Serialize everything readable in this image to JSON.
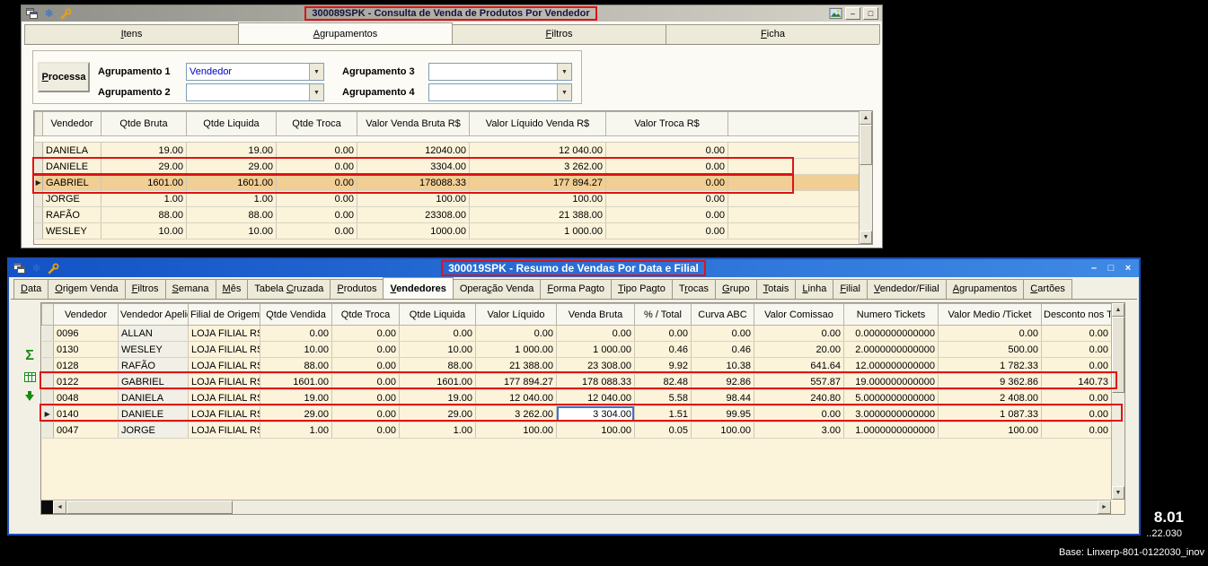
{
  "colors": {
    "annotation": "#DE1414",
    "cream": "#FBF3DA",
    "selected": "#F1CE93",
    "blue1": "#1353C6",
    "blue2": "#3F8AE4",
    "gray1": "#909088",
    "gray2": "#D6D3C9",
    "combo_text": "#0000C8",
    "green": "#168A16",
    "iceblue": "#2F6FD2"
  },
  "icons": {
    "snowflake": "❄",
    "sigma": "Σ",
    "minimize": "–",
    "maximize": "□",
    "close": "×",
    "arrow_up": "▲",
    "arrow_down": "▼",
    "arrow_left": "◄",
    "arrow_right": "►",
    "row_arrow": "▶",
    "combo_arrow": "▼"
  },
  "footer": {
    "version": "8.01",
    "build": "..22.030",
    "base": "Base: Linxerp-801-0122030_inov"
  },
  "window_consulta": {
    "title": "300089SPK - Consulta de Venda de Produtos Por Vendedor",
    "active_tab": 1,
    "tabs": [
      {
        "label": "Itens",
        "accel": 0
      },
      {
        "label": "Agrupamentos",
        "accel": 0
      },
      {
        "label": "Filtros",
        "accel": 0
      },
      {
        "label": "Ficha",
        "accel": 0
      }
    ],
    "processa": {
      "label": "Processa",
      "accel": 0
    },
    "groupings": [
      {
        "label": "Agrupamento 1",
        "value": "Vendedor"
      },
      {
        "label": "Agrupamento 2",
        "value": ""
      },
      {
        "label": "Agrupamento 3",
        "value": ""
      },
      {
        "label": "Agrupamento 4",
        "value": ""
      }
    ],
    "grid": {
      "columns": [
        "Vendedor",
        "Qtde Bruta",
        "Qtde Liquida",
        "Qtde Troca",
        "Valor Venda Bruta R$",
        "Valor Líquido Venda R$",
        "Valor Troca R$"
      ],
      "rows": [
        [
          "DANIELA",
          "19.00",
          "19.00",
          "0.00",
          "12040.00",
          "12 040.00",
          "0.00"
        ],
        [
          "DANIELE",
          "29.00",
          "29.00",
          "0.00",
          "3304.00",
          "3 262.00",
          "0.00"
        ],
        [
          "GABRIEL",
          "1601.00",
          "1601.00",
          "0.00",
          "178088.33",
          "177 894.27",
          "0.00"
        ],
        [
          "JORGE",
          "1.00",
          "1.00",
          "0.00",
          "100.00",
          "100.00",
          "0.00"
        ],
        [
          "RAFÃO",
          "88.00",
          "88.00",
          "0.00",
          "23308.00",
          "21 388.00",
          "0.00"
        ],
        [
          "WESLEY",
          "10.00",
          "10.00",
          "0.00",
          "1000.00",
          "1 000.00",
          "0.00"
        ]
      ],
      "selected_row": 2,
      "arrow_row": 2,
      "left_cols": 1
    }
  },
  "window_resumo": {
    "title": "300019SPK - Resumo de Vendas Por Data e Filial",
    "active_tab": 7,
    "tabs": [
      {
        "label": "Data",
        "accel": 0
      },
      {
        "label": "Origem Venda",
        "accel": 0
      },
      {
        "label": "Filtros",
        "accel": 0
      },
      {
        "label": "Semana",
        "accel": 0
      },
      {
        "label": "Mês",
        "accel": 0
      },
      {
        "label": "Tabela Cruzada",
        "accel": 7
      },
      {
        "label": "Produtos",
        "accel": 0
      },
      {
        "label": "Vendedores",
        "accel": 0
      },
      {
        "label": "Operação Venda",
        "accel": 5
      },
      {
        "label": "Forma Pagto",
        "accel": 0
      },
      {
        "label": "Tipo Pagto",
        "accel": 0
      },
      {
        "label": "Trocas",
        "accel": 1
      },
      {
        "label": "Grupo",
        "accel": 0
      },
      {
        "label": "Totais",
        "accel": 0
      },
      {
        "label": "Linha",
        "accel": 0
      },
      {
        "label": "Filial",
        "accel": 0
      },
      {
        "label": "Vendedor/Filial",
        "accel": 0
      },
      {
        "label": "Agrupamentos",
        "accel": 0
      },
      {
        "label": "Cartões",
        "accel": 0
      }
    ],
    "grid": {
      "columns": [
        "Vendedor",
        "Vendedor Apelido",
        "Filial de Origem",
        "Qtde Vendida",
        "Qtde Troca",
        "Qtde Liquida",
        "Valor Líquido",
        "Venda Bruta",
        "% / Total",
        "Curva ABC",
        "Valor Comissao",
        "Numero Tickets",
        "Valor Medio /Ticket",
        "Desconto nos Tick"
      ],
      "rows": [
        [
          "0096",
          "ALLAN",
          "LOJA FILIAL RS",
          "0.00",
          "0.00",
          "0.00",
          "0.00",
          "0.00",
          "0.00",
          "0.00",
          "0.00",
          "0.0000000000000",
          "0.00",
          "0.00"
        ],
        [
          "0130",
          "WESLEY",
          "LOJA FILIAL RS",
          "10.00",
          "0.00",
          "10.00",
          "1 000.00",
          "1 000.00",
          "0.46",
          "0.46",
          "20.00",
          "2.0000000000000",
          "500.00",
          "0.00"
        ],
        [
          "0128",
          "RAFÃO",
          "LOJA FILIAL RS",
          "88.00",
          "0.00",
          "88.00",
          "21 388.00",
          "23 308.00",
          "9.92",
          "10.38",
          "641.64",
          "12.000000000000",
          "1 782.33",
          "0.00"
        ],
        [
          "0122",
          "GABRIEL",
          "LOJA FILIAL RS",
          "1601.00",
          "0.00",
          "1601.00",
          "177 894.27",
          "178 088.33",
          "82.48",
          "92.86",
          "557.87",
          "19.000000000000",
          "9 362.86",
          "140.73"
        ],
        [
          "0048",
          "DANIELA",
          "LOJA FILIAL RS",
          "19.00",
          "0.00",
          "19.00",
          "12 040.00",
          "12 040.00",
          "5.58",
          "98.44",
          "240.80",
          "5.0000000000000",
          "2 408.00",
          "0.00"
        ],
        [
          "0140",
          "DANIELE",
          "LOJA FILIAL RS",
          "29.00",
          "0.00",
          "29.00",
          "3 262.00",
          "3 304.00",
          "1.51",
          "99.95",
          "0.00",
          "3.0000000000000",
          "1 087.33",
          "0.00"
        ],
        [
          "0047",
          "JORGE",
          "LOJA FILIAL RS",
          "1.00",
          "0.00",
          "1.00",
          "100.00",
          "100.00",
          "0.05",
          "100.00",
          "3.00",
          "1.0000000000000",
          "100.00",
          "0.00"
        ]
      ],
      "arrow_row": 5,
      "focus_cell": [
        5,
        7
      ],
      "left_cols": 3
    }
  }
}
